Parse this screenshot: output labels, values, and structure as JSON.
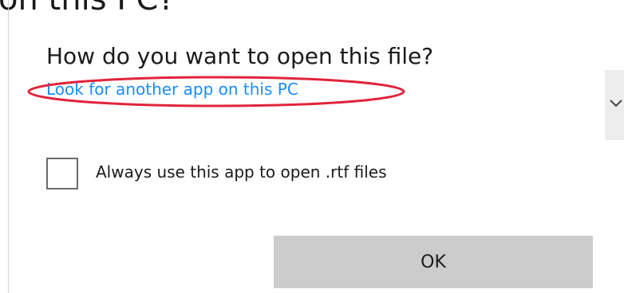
{
  "background": {
    "heading": "on this PC?"
  },
  "dialog": {
    "title": "How do you want to open this file?",
    "link_label": "Look for another app on this PC",
    "checkbox_label": "Always use this app to open .rtf files",
    "checkbox_checked": false,
    "ok_label": "OK"
  },
  "side_strip": {
    "icon": "chevron-down-icon"
  },
  "colors": {
    "link": "#1a8cff",
    "annotation": "#e0243a",
    "button_bg": "#cccccc",
    "text": "#1a1a1a"
  }
}
